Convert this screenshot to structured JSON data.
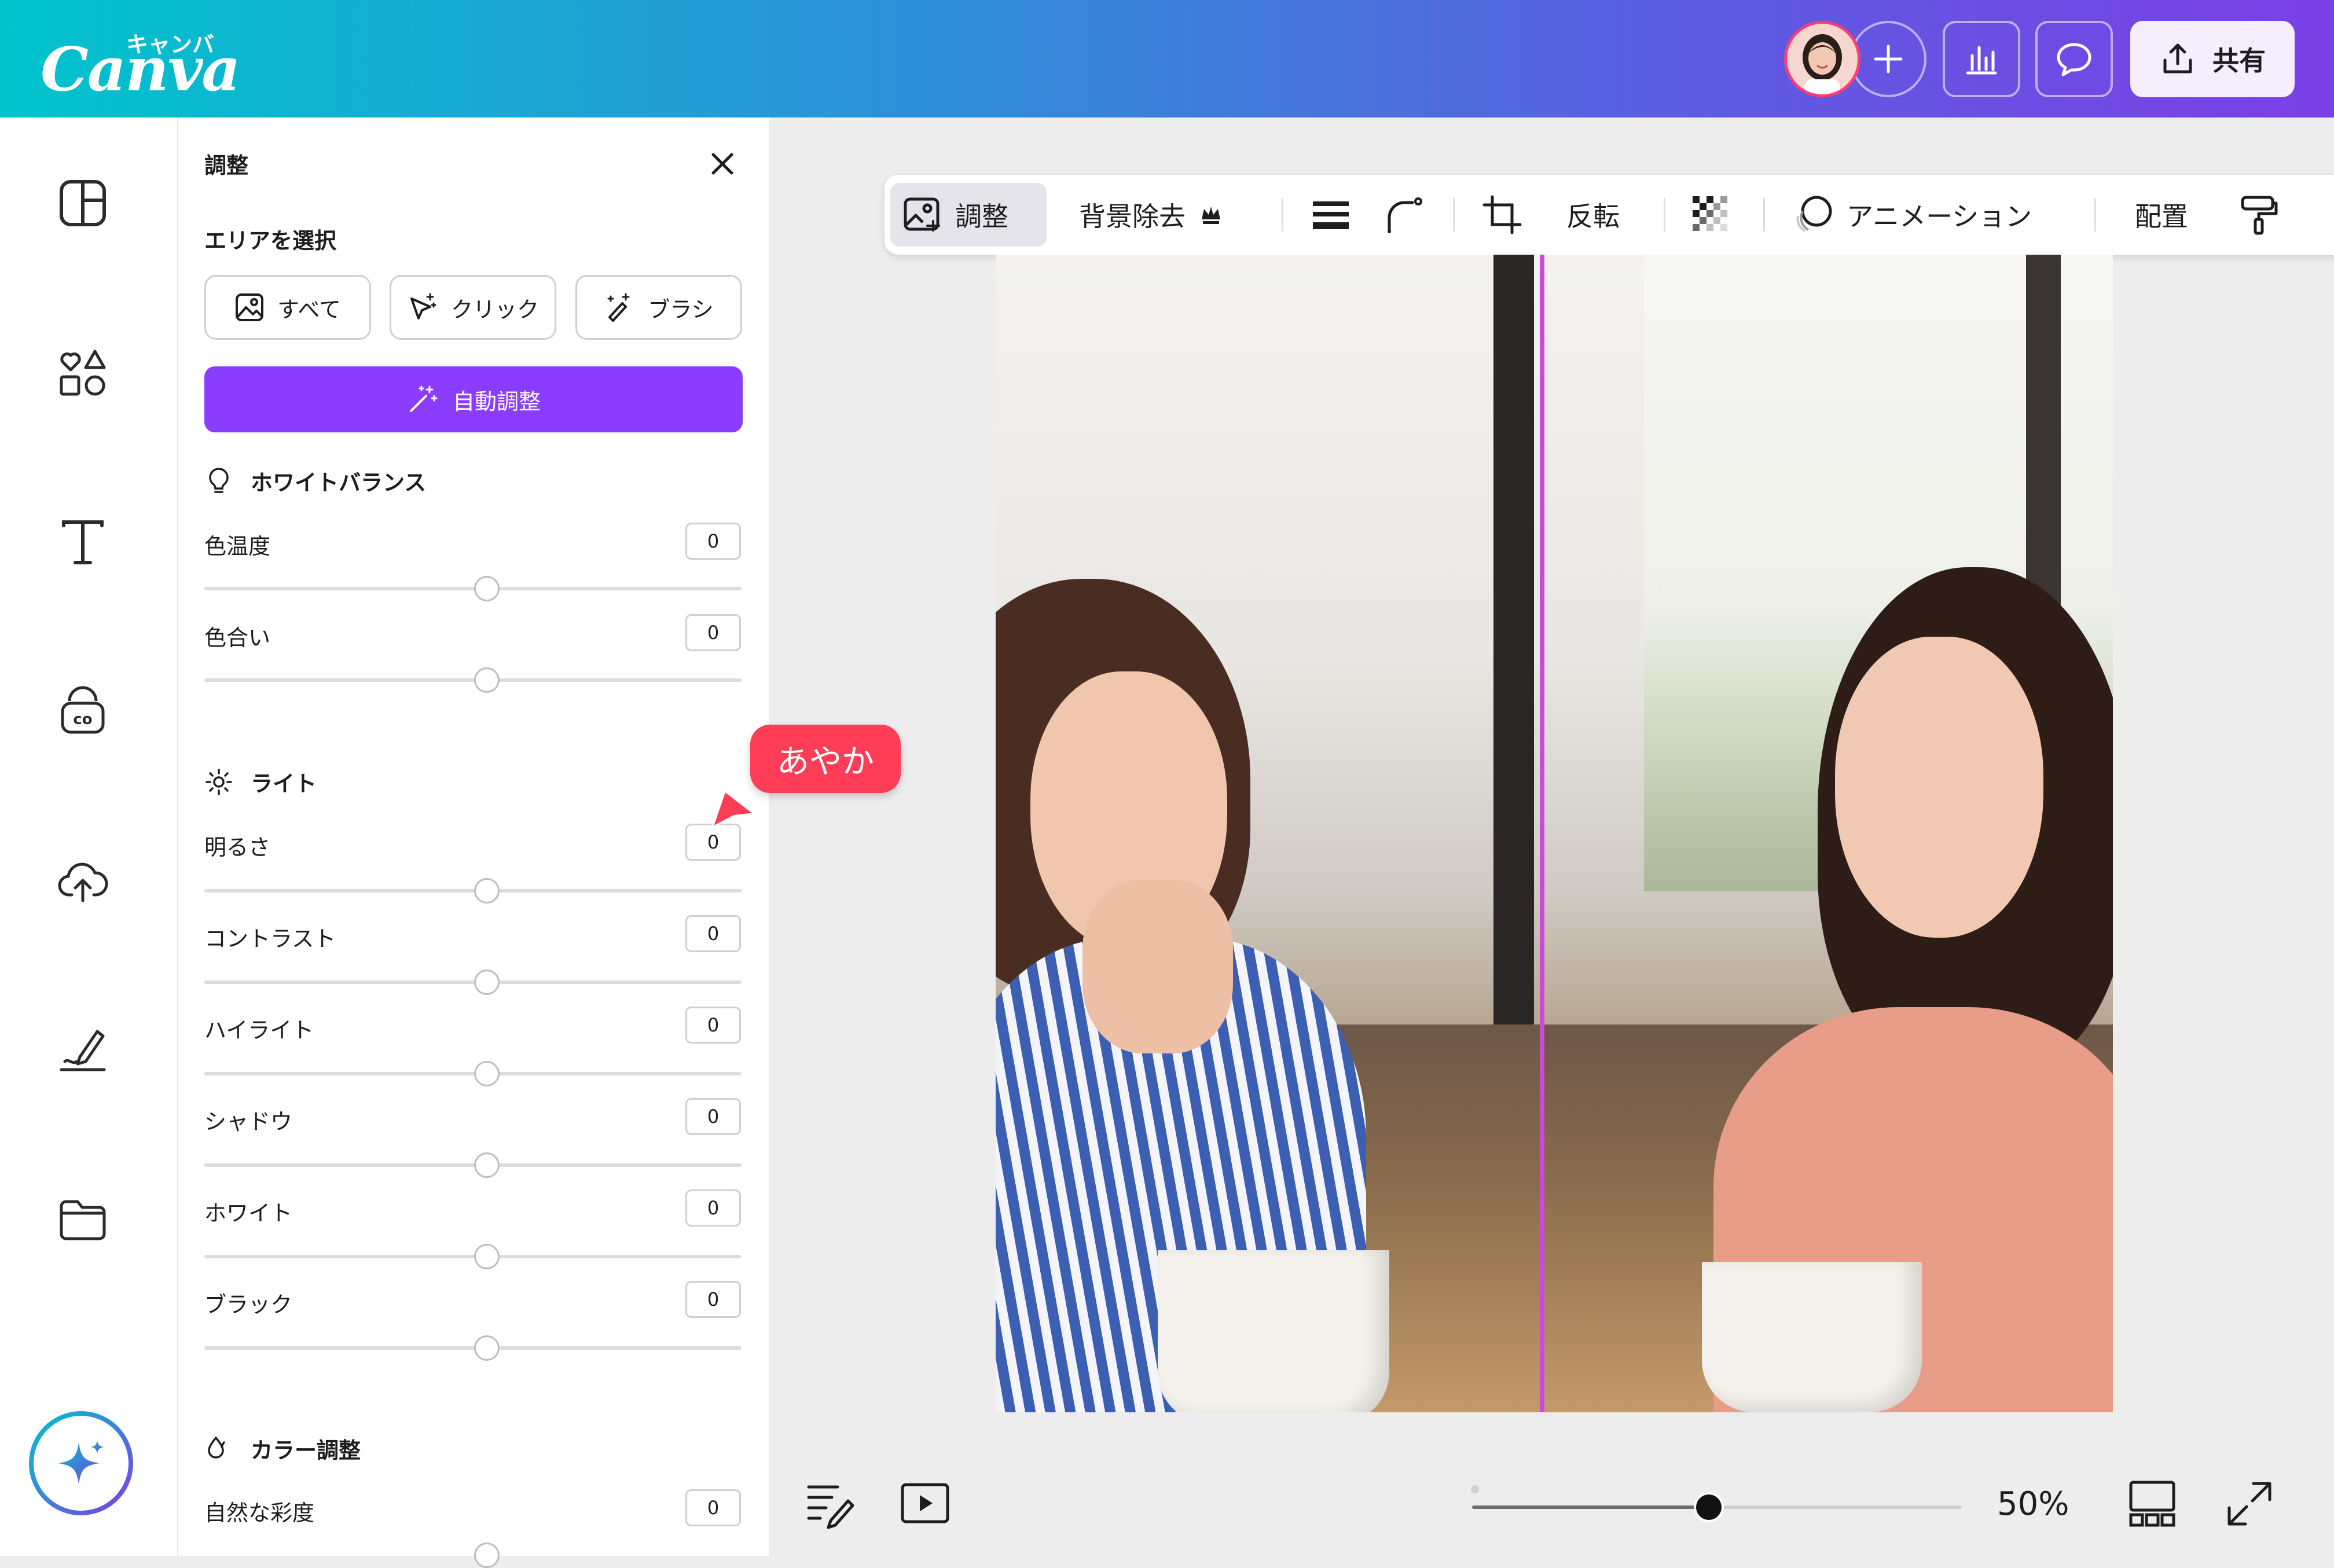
{
  "header": {
    "logo_word": "Canva",
    "logo_kana": "キャンバ",
    "share_label": "共有"
  },
  "panel": {
    "title": "調整",
    "select_area": "エリアを選択",
    "segments": [
      "すべて",
      "クリック",
      "ブラシ"
    ],
    "auto_adjust": "自動調整",
    "white_balance": {
      "title": "ホワイトバランス",
      "sliders": [
        {
          "label": "色温度",
          "value": "0"
        },
        {
          "label": "色合い",
          "value": "0"
        }
      ]
    },
    "light": {
      "title": "ライト",
      "sliders": [
        {
          "label": "明るさ",
          "value": "0"
        },
        {
          "label": "コントラスト",
          "value": "0"
        },
        {
          "label": "ハイライト",
          "value": "0"
        },
        {
          "label": "シャドウ",
          "value": "0"
        },
        {
          "label": "ホワイト",
          "value": "0"
        },
        {
          "label": "ブラック",
          "value": "0"
        }
      ]
    },
    "color": {
      "title": "カラー調整",
      "sliders": [
        {
          "label": "自然な彩度",
          "value": "0"
        }
      ]
    }
  },
  "toolbar": {
    "adjust": "調整",
    "bg_remove": "背景除去",
    "flip": "反転",
    "animation": "アニメーション",
    "position": "配置"
  },
  "collaborator_tag": "あやか",
  "zoom": {
    "label": "50%",
    "level": 0.5
  },
  "colors": {
    "accent": "#8b3dff",
    "tag": "#ff3d57",
    "header_start": "#00c4cc",
    "header_end": "#7b3fe6"
  }
}
